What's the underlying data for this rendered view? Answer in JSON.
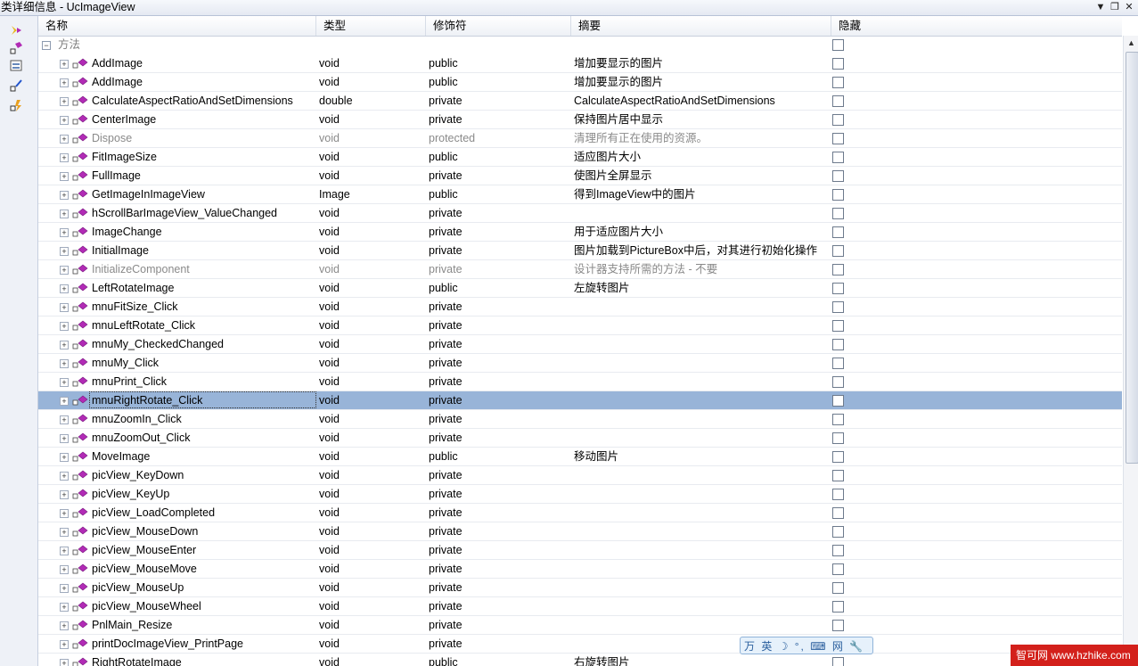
{
  "window": {
    "title": "类详细信息 - UcImageView"
  },
  "columns": [
    "名称",
    "类型",
    "修饰符",
    "摘要",
    "隐藏"
  ],
  "group": {
    "label": "方法"
  },
  "rows": [
    {
      "name": "AddImage",
      "type": "void",
      "modifier": "public",
      "summary": "增加要显示的图片",
      "hidden": false,
      "dim": false
    },
    {
      "name": "AddImage",
      "type": "void",
      "modifier": "public",
      "summary": "增加要显示的图片",
      "hidden": false,
      "dim": false
    },
    {
      "name": "CalculateAspectRatioAndSetDimensions",
      "type": "double",
      "modifier": "private",
      "summary": "CalculateAspectRatioAndSetDimensions",
      "hidden": false,
      "dim": false
    },
    {
      "name": "CenterImage",
      "type": "void",
      "modifier": "private",
      "summary": "保持图片居中显示",
      "hidden": false,
      "dim": false
    },
    {
      "name": "Dispose",
      "type": "void",
      "modifier": "protected",
      "summary": "清理所有正在使用的资源。",
      "hidden": false,
      "dim": true
    },
    {
      "name": "FitImageSize",
      "type": "void",
      "modifier": "public",
      "summary": "适应图片大小",
      "hidden": false,
      "dim": false
    },
    {
      "name": "FullImage",
      "type": "void",
      "modifier": "private",
      "summary": "使图片全屏显示",
      "hidden": false,
      "dim": false
    },
    {
      "name": "GetImageInImageView",
      "type": "Image",
      "modifier": "public",
      "summary": "得到ImageView中的图片",
      "hidden": false,
      "dim": false
    },
    {
      "name": "hScrollBarImageView_ValueChanged",
      "type": "void",
      "modifier": "private",
      "summary": "",
      "hidden": false,
      "dim": false
    },
    {
      "name": "ImageChange",
      "type": "void",
      "modifier": "private",
      "summary": "用于适应图片大小",
      "hidden": false,
      "dim": false
    },
    {
      "name": "InitialImage",
      "type": "void",
      "modifier": "private",
      "summary": "图片加载到PictureBox中后，对其进行初始化操作",
      "hidden": false,
      "dim": false
    },
    {
      "name": "InitializeComponent",
      "type": "void",
      "modifier": "private",
      "summary": "设计器支持所需的方法 - 不要",
      "hidden": false,
      "dim": true
    },
    {
      "name": "LeftRotateImage",
      "type": "void",
      "modifier": "public",
      "summary": "左旋转图片",
      "hidden": false,
      "dim": false
    },
    {
      "name": "mnuFitSize_Click",
      "type": "void",
      "modifier": "private",
      "summary": "",
      "hidden": false,
      "dim": false
    },
    {
      "name": "mnuLeftRotate_Click",
      "type": "void",
      "modifier": "private",
      "summary": "",
      "hidden": false,
      "dim": false
    },
    {
      "name": "mnuMy_CheckedChanged",
      "type": "void",
      "modifier": "private",
      "summary": "",
      "hidden": false,
      "dim": false
    },
    {
      "name": "mnuMy_Click",
      "type": "void",
      "modifier": "private",
      "summary": "",
      "hidden": false,
      "dim": false
    },
    {
      "name": "mnuPrint_Click",
      "type": "void",
      "modifier": "private",
      "summary": "",
      "hidden": false,
      "dim": false
    },
    {
      "name": "mnuRightRotate_Click",
      "type": "void",
      "modifier": "private",
      "summary": "",
      "hidden": false,
      "dim": false,
      "selected": true
    },
    {
      "name": "mnuZoomIn_Click",
      "type": "void",
      "modifier": "private",
      "summary": "",
      "hidden": false,
      "dim": false
    },
    {
      "name": "mnuZoomOut_Click",
      "type": "void",
      "modifier": "private",
      "summary": "",
      "hidden": false,
      "dim": false
    },
    {
      "name": "MoveImage",
      "type": "void",
      "modifier": "public",
      "summary": "移动图片",
      "hidden": false,
      "dim": false
    },
    {
      "name": "picView_KeyDown",
      "type": "void",
      "modifier": "private",
      "summary": "",
      "hidden": false,
      "dim": false
    },
    {
      "name": "picView_KeyUp",
      "type": "void",
      "modifier": "private",
      "summary": "",
      "hidden": false,
      "dim": false
    },
    {
      "name": "picView_LoadCompleted",
      "type": "void",
      "modifier": "private",
      "summary": "",
      "hidden": false,
      "dim": false
    },
    {
      "name": "picView_MouseDown",
      "type": "void",
      "modifier": "private",
      "summary": "",
      "hidden": false,
      "dim": false
    },
    {
      "name": "picView_MouseEnter",
      "type": "void",
      "modifier": "private",
      "summary": "",
      "hidden": false,
      "dim": false
    },
    {
      "name": "picView_MouseMove",
      "type": "void",
      "modifier": "private",
      "summary": "",
      "hidden": false,
      "dim": false
    },
    {
      "name": "picView_MouseUp",
      "type": "void",
      "modifier": "private",
      "summary": "",
      "hidden": false,
      "dim": false
    },
    {
      "name": "picView_MouseWheel",
      "type": "void",
      "modifier": "private",
      "summary": "",
      "hidden": false,
      "dim": false
    },
    {
      "name": "PnlMain_Resize",
      "type": "void",
      "modifier": "private",
      "summary": "",
      "hidden": false,
      "dim": false
    },
    {
      "name": "printDocImageView_PrintPage",
      "type": "void",
      "modifier": "private",
      "summary": "",
      "hidden": false,
      "dim": false
    },
    {
      "name": "RightRotateImage",
      "type": "void",
      "modifier": "public",
      "summary": "右旋转图片",
      "hidden": false,
      "dim": false
    }
  ],
  "ime_toolbar": {
    "text": "万 英 ☽ °, ⌨ 网 🔧"
  },
  "watermark": {
    "text": "智可网 www.hzhike.com"
  },
  "colors": {
    "selected_row": "#98b4d8",
    "method_icon": "#b12bb5",
    "watermark_bg": "#d3201b"
  }
}
